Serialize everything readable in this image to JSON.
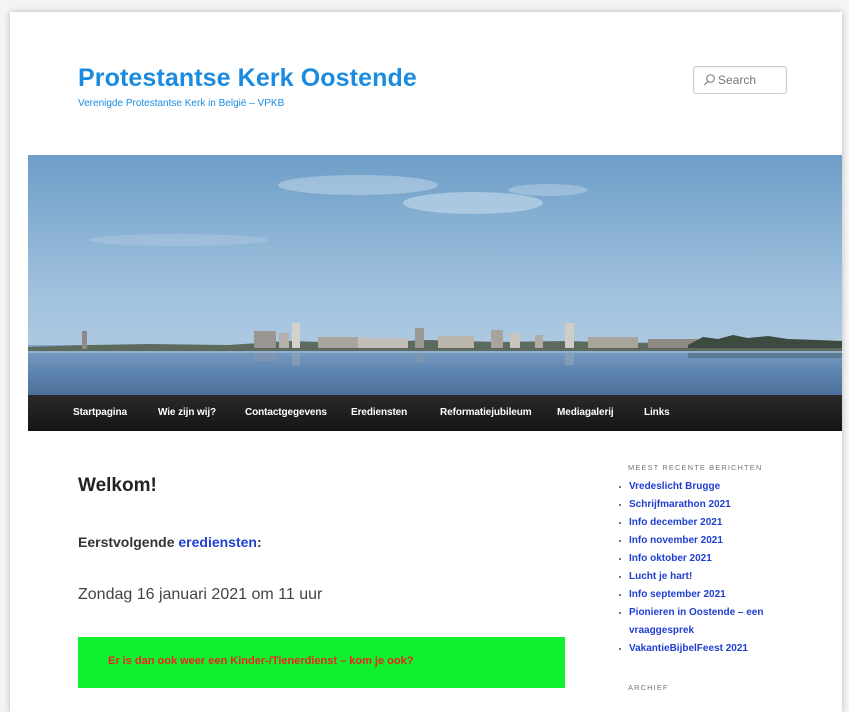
{
  "header": {
    "site_title": "Protestantse Kerk Oostende",
    "tagline": "Verenigde Protestantse Kerk in België – VPKB"
  },
  "search": {
    "placeholder": "Search",
    "icon": "search-icon"
  },
  "nav": {
    "items": [
      {
        "label": "Startpagina"
      },
      {
        "label": "Wie zijn wij?"
      },
      {
        "label": "Contactgegevens"
      },
      {
        "label": "Erediensten"
      },
      {
        "label": "Reformatiejubileum"
      },
      {
        "label": "Mediagalerij"
      },
      {
        "label": "Links"
      }
    ]
  },
  "main": {
    "heading": "Welkom!",
    "next_services_prefix": "Eerstvolgende ",
    "next_services_link": "erediensten",
    "next_services_suffix": ":",
    "date_line": "Zondag 16 januari 2021 om 11 uur",
    "notice": "Er is dan ook weer een Kinder-/Tienerdienst – kom je ook?"
  },
  "sidebar": {
    "recent_title": "MEEST RECENTE BERICHTEN",
    "recent_posts": [
      "Vredeslicht Brugge",
      "Schrijfmarathon 2021",
      "Info december 2021",
      "Info november 2021",
      "Info oktober 2021",
      "Lucht je hart!",
      "Info september 2021",
      "Pionieren in Oostende – een vraaggesprek",
      "VakantieBijbelFeest 2021"
    ],
    "archive_title": "ARCHIEF"
  },
  "colors": {
    "title_blue": "#1b8be0",
    "link_blue": "#1f3fd0",
    "notice_bg": "#0ff02e",
    "notice_text": "#e22222",
    "nav_bg": "#1c1c1c"
  }
}
